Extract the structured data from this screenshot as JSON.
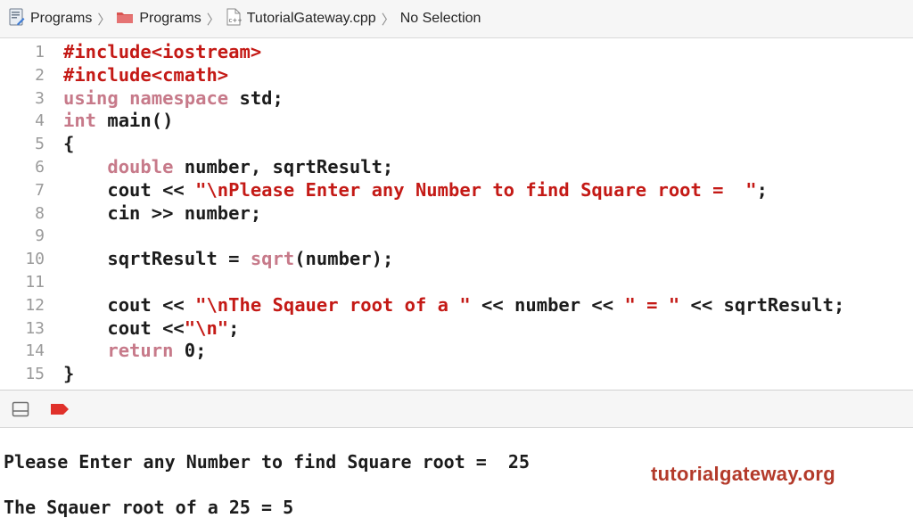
{
  "jumpbar": {
    "crumbs": [
      {
        "label": "Programs",
        "icon": "project-icon"
      },
      {
        "label": "Programs",
        "icon": "folder-icon"
      },
      {
        "label": "TutorialGateway.cpp",
        "icon": "cpp-file-icon"
      },
      {
        "label": "No Selection"
      }
    ]
  },
  "editor": {
    "lines": [
      {
        "n": "1",
        "parts": [
          {
            "t": "#include<iostream>",
            "c": "pp"
          }
        ]
      },
      {
        "n": "2",
        "parts": [
          {
            "t": "#include<cmath>",
            "c": "pp"
          }
        ]
      },
      {
        "n": "3",
        "parts": [
          {
            "t": "using",
            "c": "kw"
          },
          {
            "t": " ",
            "c": ""
          },
          {
            "t": "namespace",
            "c": "kw"
          },
          {
            "t": " std;",
            "c": ""
          }
        ]
      },
      {
        "n": "4",
        "parts": [
          {
            "t": "int",
            "c": "kw"
          },
          {
            "t": " main()",
            "c": ""
          }
        ]
      },
      {
        "n": "5",
        "parts": [
          {
            "t": "{",
            "c": ""
          }
        ]
      },
      {
        "n": "6",
        "parts": [
          {
            "t": "    ",
            "c": ""
          },
          {
            "t": "double",
            "c": "kw"
          },
          {
            "t": " number, sqrtResult;",
            "c": ""
          }
        ]
      },
      {
        "n": "7",
        "parts": [
          {
            "t": "    cout << ",
            "c": ""
          },
          {
            "t": "\"\\nPlease Enter any Number to find Square root =  \"",
            "c": "str"
          },
          {
            "t": ";",
            "c": ""
          }
        ]
      },
      {
        "n": "8",
        "parts": [
          {
            "t": "    cin >> number;",
            "c": ""
          }
        ]
      },
      {
        "n": "9",
        "parts": []
      },
      {
        "n": "10",
        "parts": [
          {
            "t": "    sqrtResult = ",
            "c": ""
          },
          {
            "t": "sqrt",
            "c": "kw"
          },
          {
            "t": "(number);",
            "c": ""
          }
        ]
      },
      {
        "n": "11",
        "parts": []
      },
      {
        "n": "12",
        "parts": [
          {
            "t": "    cout << ",
            "c": ""
          },
          {
            "t": "\"\\nThe Sqauer root of a \"",
            "c": "str"
          },
          {
            "t": " << number << ",
            "c": ""
          },
          {
            "t": "\" = \"",
            "c": "str"
          },
          {
            "t": " << sqrtResult;",
            "c": ""
          }
        ]
      },
      {
        "n": "13",
        "parts": [
          {
            "t": "    cout <<",
            "c": ""
          },
          {
            "t": "\"\\n\"",
            "c": "str"
          },
          {
            "t": ";",
            "c": ""
          }
        ]
      },
      {
        "n": "14",
        "parts": [
          {
            "t": "    ",
            "c": ""
          },
          {
            "t": "return",
            "c": "kw"
          },
          {
            "t": " ",
            "c": ""
          },
          {
            "t": "0",
            "c": "num"
          },
          {
            "t": ";",
            "c": ""
          }
        ]
      },
      {
        "n": "15",
        "parts": [
          {
            "t": "}",
            "c": ""
          }
        ]
      }
    ]
  },
  "debugbar": {
    "toggle_icon": "hide-panel-icon",
    "breakpoint_icon": "breakpoint-icon"
  },
  "console": {
    "line1": "Please Enter any Number to find Square root =  25",
    "line2": "The Sqauer root of a 25 = 5"
  },
  "watermark": "tutorialgateway.org",
  "colors": {
    "string": "#c41a16",
    "keyword": "#c77a8a",
    "watermark": "#b33a2a",
    "breakpoint": "#e0312b"
  }
}
